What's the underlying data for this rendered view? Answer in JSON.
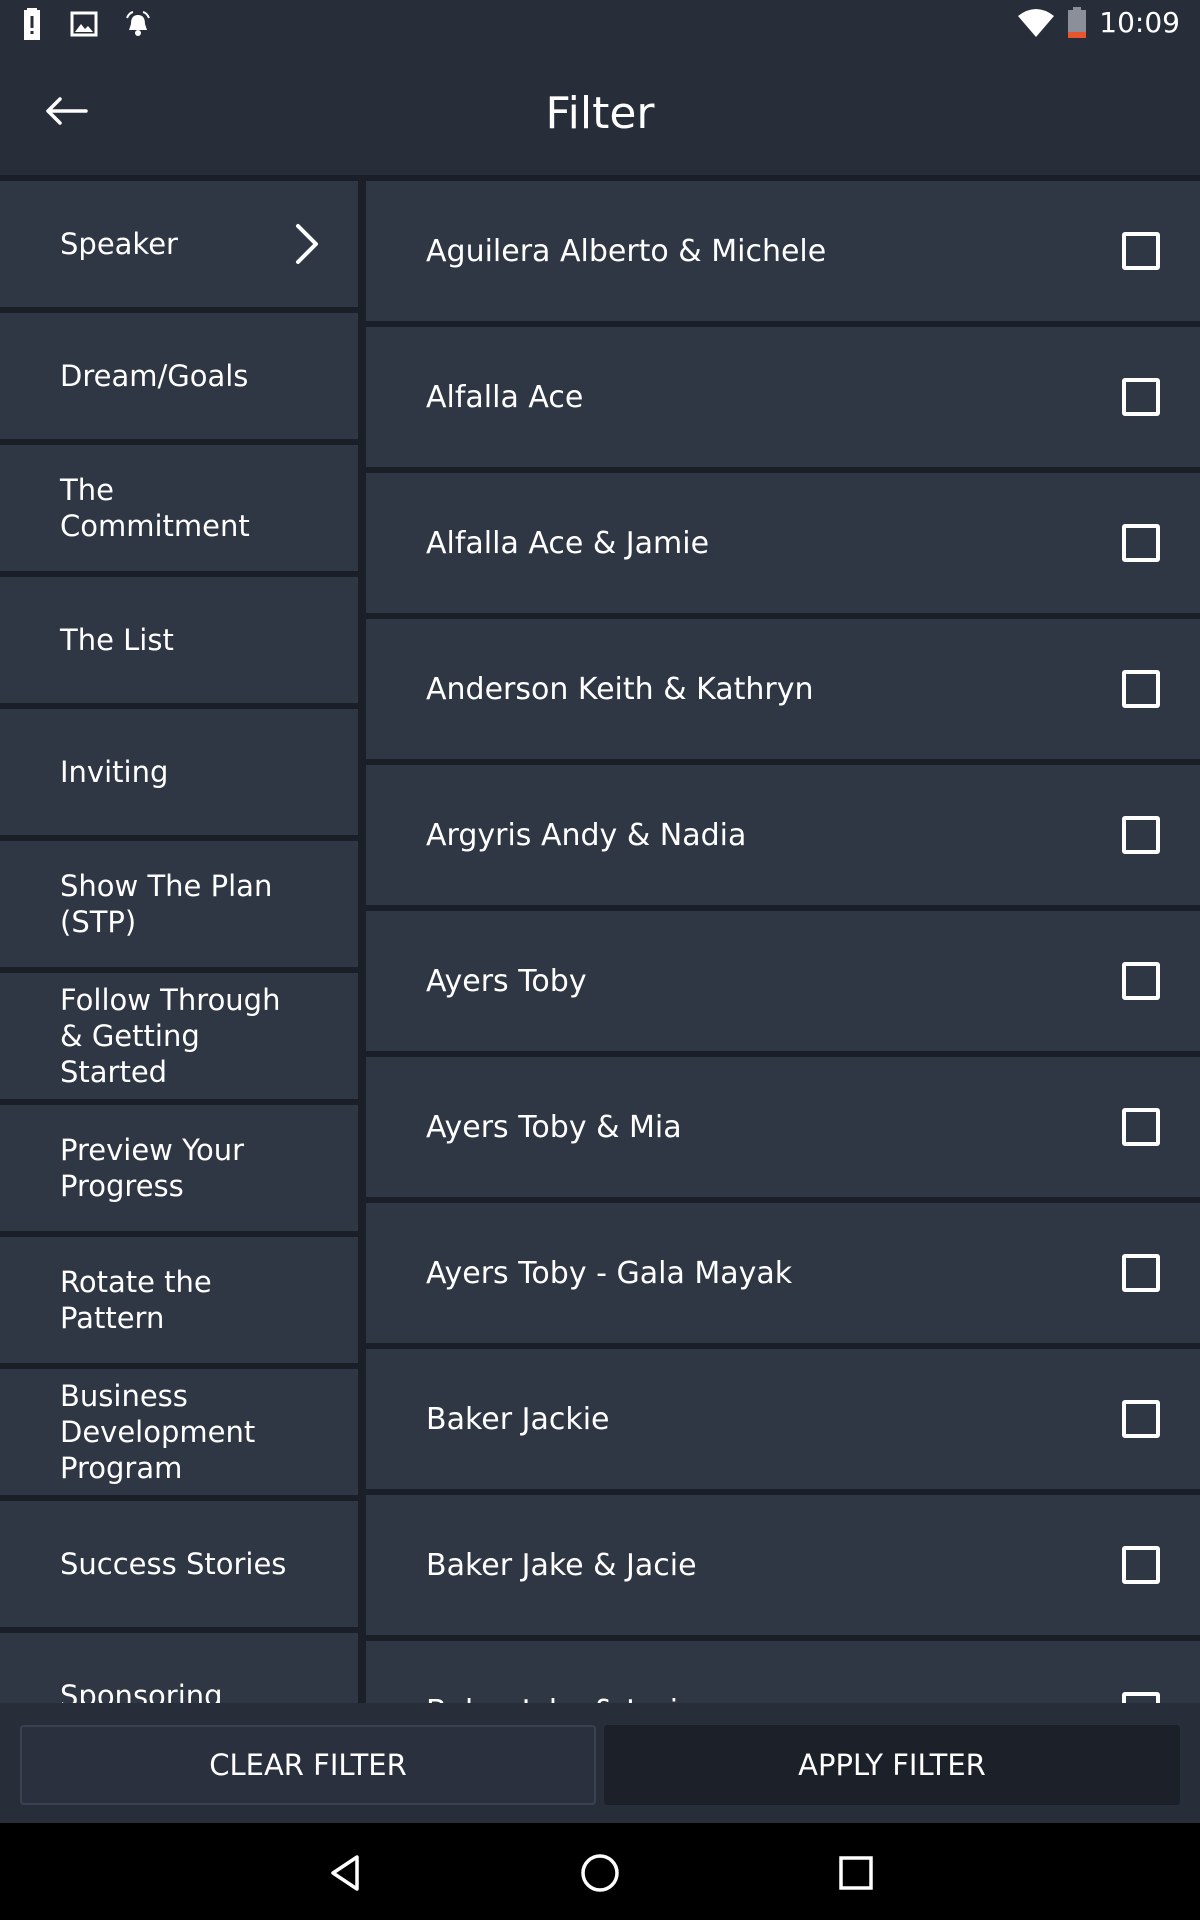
{
  "status_bar": {
    "time": "10:09",
    "left_icons": [
      "alert-icon",
      "image-icon",
      "alarm-icon"
    ],
    "right_icons": [
      "wifi-icon",
      "battery-low-icon"
    ],
    "battery_color": "#e8542b"
  },
  "header": {
    "title": "Filter",
    "back_icon": "arrow-left-icon"
  },
  "categories": [
    {
      "label": "Speaker",
      "selected": true
    },
    {
      "label": "Dream/Goals"
    },
    {
      "label": "The\nCommitment"
    },
    {
      "label": "The List"
    },
    {
      "label": "Inviting"
    },
    {
      "label": "Show The Plan\n(STP)"
    },
    {
      "label": "Follow Through\n& Getting\nStarted"
    },
    {
      "label": "Preview Your\nProgress"
    },
    {
      "label": "Rotate the\nPattern"
    },
    {
      "label": "Business\nDevelopment\nProgram"
    },
    {
      "label": "Success Stories"
    },
    {
      "label": "Sponsoring"
    }
  ],
  "speakers": [
    {
      "name": "Aguilera Alberto & Michele",
      "checked": false
    },
    {
      "name": "Alfalla Ace",
      "checked": false
    },
    {
      "name": "Alfalla Ace & Jamie",
      "checked": false
    },
    {
      "name": "Anderson Keith & Kathryn",
      "checked": false
    },
    {
      "name": "Argyris Andy & Nadia",
      "checked": false
    },
    {
      "name": "Ayers Toby",
      "checked": false
    },
    {
      "name": "Ayers Toby & Mia",
      "checked": false
    },
    {
      "name": "Ayers Toby - Gala Mayak",
      "checked": false
    },
    {
      "name": "Baker Jackie",
      "checked": false
    },
    {
      "name": "Baker Jake & Jacie",
      "checked": false
    },
    {
      "name": "Baker Jake & Jacie",
      "checked": false
    }
  ],
  "buttons": {
    "clear": "CLEAR FILTER",
    "apply": "APPLY FILTER"
  },
  "nav_bar": [
    "back-triangle-icon",
    "home-circle-icon",
    "recents-square-icon"
  ]
}
